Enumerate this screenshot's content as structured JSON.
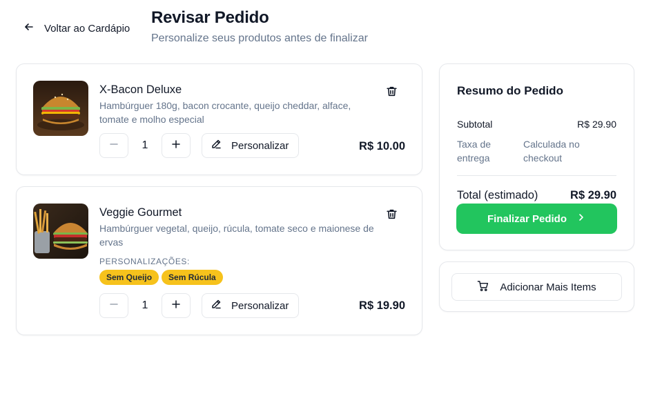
{
  "header": {
    "back_label": "Voltar ao Cardápio",
    "title": "Revisar Pedido",
    "subtitle": "Personalize seus produtos antes de finalizar"
  },
  "cart_items": [
    {
      "name": "X-Bacon Deluxe",
      "description": "Hambúrguer 180g, bacon crocante, queijo cheddar, alface, tomate e molho especial",
      "quantity": "1",
      "personalize_label": "Personalizar",
      "price": "R$ 10.00",
      "image_icon": "burger-photo"
    },
    {
      "name": "Veggie Gourmet",
      "description": "Hambúrguer vegetal, queijo, rúcula, tomate seco e maionese de ervas",
      "quantity": "1",
      "personalize_label": "Personalizar",
      "price": "R$ 19.90",
      "customizations_label": "PERSONALIZAÇÕES:",
      "customizations": [
        "Sem Queijo",
        "Sem Rúcula"
      ],
      "image_icon": "veggie-burger-fries-photo"
    }
  ],
  "summary": {
    "title": "Resumo do Pedido",
    "subtotal_label": "Subtotal",
    "subtotal_value": "R$ 29.90",
    "shipping_label": "Taxa de entrega",
    "shipping_value": "Calculada no checkout",
    "total_label": "Total (estimado)",
    "total_value": "R$ 29.90",
    "finish_label": "Finalizar Pedido"
  },
  "add_more": {
    "label": "Adicionar Mais Items"
  },
  "colors": {
    "accent_green": "#22c55e",
    "tag_yellow": "#f6c21c",
    "muted_text": "#64748b",
    "border": "#e5e7eb"
  }
}
